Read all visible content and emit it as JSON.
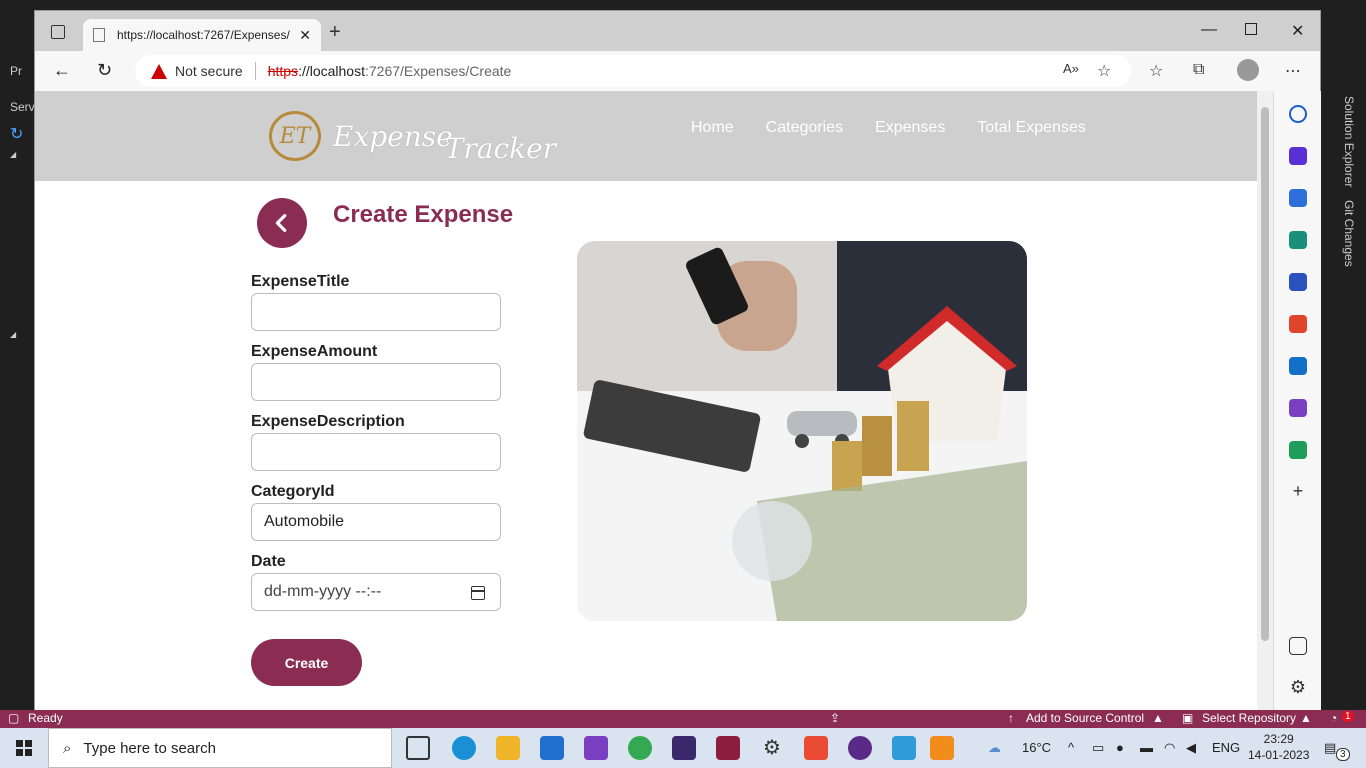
{
  "vs": {
    "left_labels": [
      "Serv",
      "Pr"
    ],
    "right_tabs": [
      "Solution Explorer",
      "Git Changes"
    ],
    "status": {
      "ready": "Ready",
      "source_control": "Add to Source Control",
      "repository": "Select Repository",
      "notifications": "1"
    }
  },
  "browser": {
    "tab_title": "https://localhost:7267/Expenses/",
    "security_label": "Not secure",
    "url": {
      "scheme": "https",
      "host": "://localhost",
      "path": ":7267/Expenses/Create"
    }
  },
  "site": {
    "logo_initials": "ET",
    "logo_word1": "Expense",
    "logo_word2": "Tracker",
    "nav": [
      "Home",
      "Categories",
      "Expenses",
      "Total Expenses"
    ]
  },
  "form": {
    "title": "Create Expense",
    "fields": [
      {
        "label": "ExpenseTitle",
        "value": ""
      },
      {
        "label": "ExpenseAmount",
        "value": ""
      },
      {
        "label": "ExpenseDescription",
        "value": ""
      },
      {
        "label": "CategoryId",
        "value": "Automobile"
      },
      {
        "label": "Date",
        "placeholder": "dd-mm-yyyy --:--"
      }
    ],
    "submit_label": "Create"
  },
  "taskbar": {
    "search_placeholder": "Type here to search",
    "weather": "16°C",
    "language": "ENG",
    "time": "23:29",
    "date": "14-01-2023",
    "notification_count": "3"
  },
  "colors": {
    "brand": "#8b2d52",
    "header_bg": "#cfcfcf"
  }
}
